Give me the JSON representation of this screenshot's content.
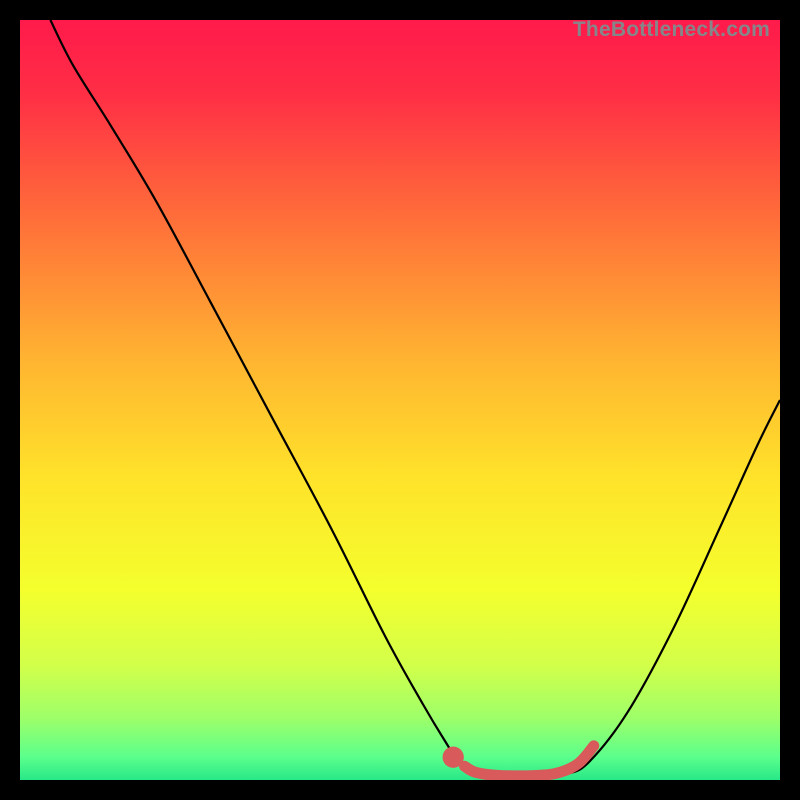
{
  "watermark": "TheBottleneck.com",
  "chart_data": {
    "type": "line",
    "title": "",
    "xlabel": "",
    "ylabel": "",
    "xlim": [
      0,
      100
    ],
    "ylim": [
      0,
      100
    ],
    "background_gradient": {
      "stops": [
        {
          "offset": 0.0,
          "color": "#ff1a4b"
        },
        {
          "offset": 0.1,
          "color": "#ff2f45"
        },
        {
          "offset": 0.25,
          "color": "#ff6a3a"
        },
        {
          "offset": 0.45,
          "color": "#ffb531"
        },
        {
          "offset": 0.6,
          "color": "#ffe22a"
        },
        {
          "offset": 0.75,
          "color": "#f4ff2d"
        },
        {
          "offset": 0.85,
          "color": "#d2ff4a"
        },
        {
          "offset": 0.92,
          "color": "#9cff6a"
        },
        {
          "offset": 0.97,
          "color": "#5bff8c"
        },
        {
          "offset": 1.0,
          "color": "#28e888"
        }
      ]
    },
    "series": [
      {
        "name": "bottleneck-curve",
        "color": "#000000",
        "width": 2.2,
        "points": [
          {
            "x": 4.0,
            "y": 100.0
          },
          {
            "x": 7.0,
            "y": 94.0
          },
          {
            "x": 12.0,
            "y": 86.0
          },
          {
            "x": 18.0,
            "y": 76.0
          },
          {
            "x": 25.0,
            "y": 63.0
          },
          {
            "x": 33.0,
            "y": 48.0
          },
          {
            "x": 41.0,
            "y": 33.0
          },
          {
            "x": 48.0,
            "y": 19.0
          },
          {
            "x": 53.0,
            "y": 10.0
          },
          {
            "x": 56.0,
            "y": 5.0
          },
          {
            "x": 58.0,
            "y": 2.0
          },
          {
            "x": 60.0,
            "y": 0.8
          },
          {
            "x": 63.0,
            "y": 0.3
          },
          {
            "x": 68.0,
            "y": 0.3
          },
          {
            "x": 72.0,
            "y": 0.8
          },
          {
            "x": 75.0,
            "y": 2.5
          },
          {
            "x": 80.0,
            "y": 9.0
          },
          {
            "x": 86.0,
            "y": 20.0
          },
          {
            "x": 92.0,
            "y": 33.0
          },
          {
            "x": 97.0,
            "y": 44.0
          },
          {
            "x": 100.0,
            "y": 50.0
          }
        ]
      },
      {
        "name": "highlight-segment",
        "color": "#d95a5a",
        "width": 11,
        "linecap": "round",
        "points": [
          {
            "x": 58.5,
            "y": 1.8
          },
          {
            "x": 60.0,
            "y": 1.0
          },
          {
            "x": 63.0,
            "y": 0.6
          },
          {
            "x": 68.0,
            "y": 0.6
          },
          {
            "x": 71.0,
            "y": 1.0
          },
          {
            "x": 73.5,
            "y": 2.2
          },
          {
            "x": 75.5,
            "y": 4.5
          }
        ]
      }
    ],
    "markers": [
      {
        "name": "highlight-dot",
        "x": 57.0,
        "y": 3.0,
        "r": 1.4,
        "color": "#d95a5a"
      }
    ]
  }
}
